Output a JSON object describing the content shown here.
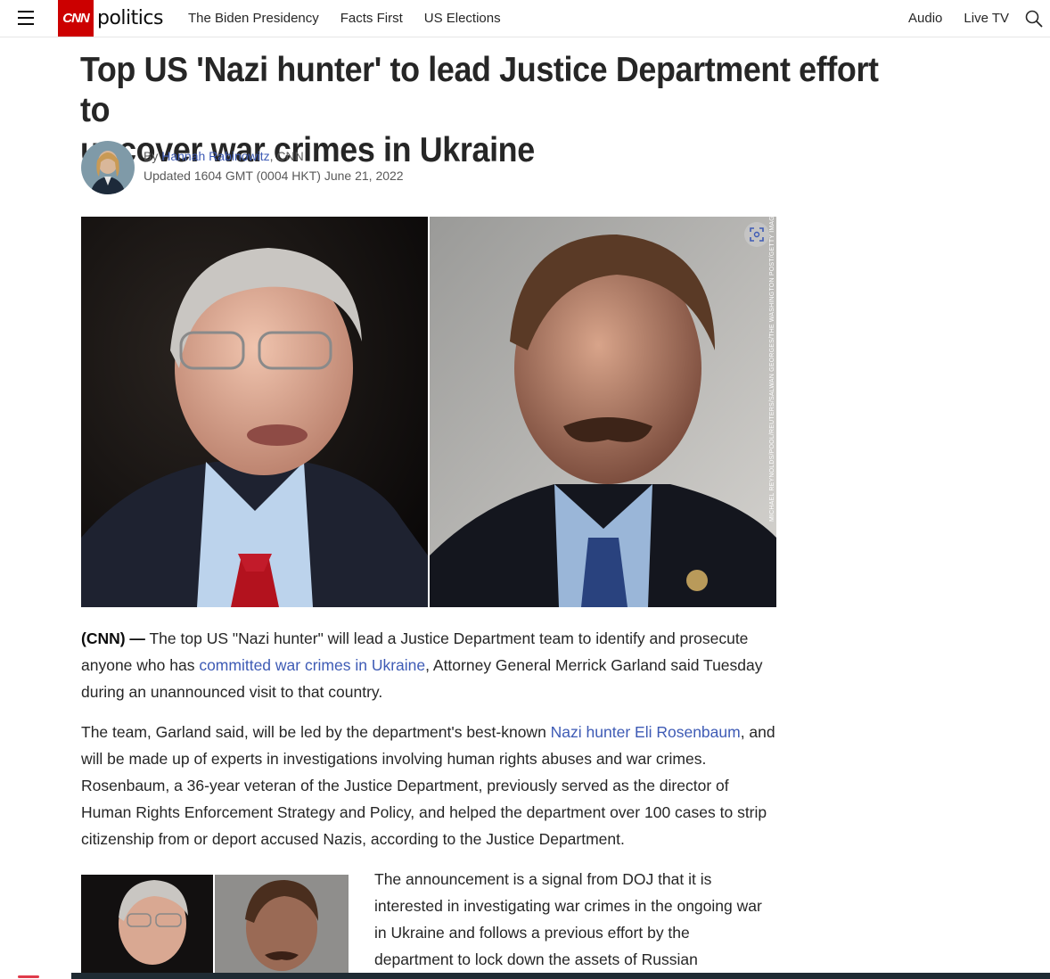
{
  "header": {
    "logo_text": "CNN",
    "section": "politics",
    "nav": [
      "The Biden Presidency",
      "Facts First",
      "US Elections"
    ],
    "right_nav": [
      "Audio",
      "Live TV"
    ]
  },
  "article": {
    "headline_line1": "Top US 'Nazi hunter' to lead Justice Department effort to",
    "headline_line2": "uncover war crimes in Ukraine",
    "byline_prefix": "By ",
    "author": "Hannah Rabinowitz",
    "byline_suffix": ", CNN",
    "updated": "Updated 1604 GMT (0004 HKT) June 21, 2022",
    "image_credit": "MICHAEL REYNOLDS/POOL/REUTERS/SALWAN GEORGES/THE WASHINGTON POST/GETTY IMAGES",
    "p1_dateline": "(CNN) —",
    "p1_a": " The top US \"Nazi hunter\" will lead a Justice Department team to identify and prosecute anyone who has ",
    "p1_link": "committed war crimes in Ukraine",
    "p1_b": ", Attorney General Merrick Garland said Tuesday during an unannounced visit to that country.",
    "p2_a": "The team, Garland said, will be led by the department's best-known ",
    "p2_link": "Nazi hunter Eli Rosenbaum",
    "p2_b": ", and will be made up of experts in investigations involving human rights abuses and war crimes. Rosenbaum, a 36-year veteran of the Justice Department, previously served as the director of Human Rights Enforcement Strategy and Policy, and helped the department over 100 cases to strip citizenship from or deport accused Nazis, according to the Justice Department.",
    "p3": "The announcement is a signal from DOJ that it is interested in investigating war crimes in the ongoing war in Ukraine and follows a previous effort by the department to lock down the assets of Russian"
  },
  "colors": {
    "brand_red": "#cc0000",
    "link": "#3e5bb5"
  }
}
